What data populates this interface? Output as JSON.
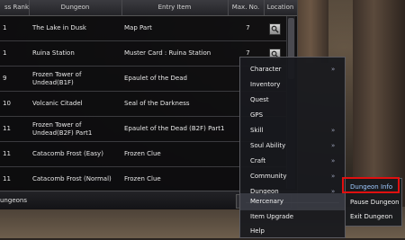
{
  "table": {
    "headers": {
      "rank": "ss Rank",
      "dungeon": "Dungeon",
      "entry_item": "Entry Item",
      "max_no": "Max. No.",
      "location": "Location"
    },
    "rows": [
      {
        "rank": "1",
        "dungeon": "The Lake in Dusk",
        "entry_item": "Map Part",
        "max_no": "7",
        "has_location": true
      },
      {
        "rank": "1",
        "dungeon": "Ruina Station",
        "entry_item": "Muster Card : Ruina Station",
        "max_no": "7",
        "has_location": true
      },
      {
        "rank": "9",
        "dungeon": "Frozen Tower of Undead(B1F)",
        "entry_item": "Epaulet of the Dead",
        "max_no": "",
        "has_location": false
      },
      {
        "rank": "10",
        "dungeon": "Volcanic Citadel",
        "entry_item": "Seal of the Darkness",
        "max_no": "",
        "has_location": false
      },
      {
        "rank": "11",
        "dungeon": "Frozen Tower of Undead(B2F) Part1",
        "entry_item": "Epaulet of the Dead (B2F) Part1",
        "max_no": "",
        "has_location": false
      },
      {
        "rank": "11",
        "dungeon": "Catacomb Frost (Easy)",
        "entry_item": "Frozen Clue",
        "max_no": "",
        "has_location": false
      },
      {
        "rank": "11",
        "dungeon": "Catacomb Frost (Normal)",
        "entry_item": "Frozen Clue",
        "max_no": "",
        "has_location": false
      }
    ],
    "footer_label": "ungeons",
    "location_icon": "search-icon"
  },
  "menu": {
    "items": [
      {
        "label": "Character",
        "arrow": "»"
      },
      {
        "label": "Inventory",
        "arrow": ""
      },
      {
        "label": "Quest",
        "arrow": ""
      },
      {
        "label": "GPS",
        "arrow": ""
      },
      {
        "label": "Skill",
        "arrow": "»"
      },
      {
        "label": "Soul Ability",
        "arrow": "»"
      },
      {
        "label": "Craft",
        "arrow": "»"
      },
      {
        "label": "Community",
        "arrow": "»"
      },
      {
        "label": "Dungeon",
        "arrow": "»"
      },
      {
        "label": "Mercenary",
        "arrow": ""
      },
      {
        "label": "Item Upgrade",
        "arrow": ""
      },
      {
        "label": "Help",
        "arrow": ""
      }
    ]
  },
  "submenu": {
    "items": [
      {
        "label": "Dungeon Info"
      },
      {
        "label": "Pause Dungeon"
      },
      {
        "label": "Exit Dungeon"
      }
    ]
  },
  "colors": {
    "highlight_border": "#e01010",
    "active_text": "#9ec9ff"
  }
}
